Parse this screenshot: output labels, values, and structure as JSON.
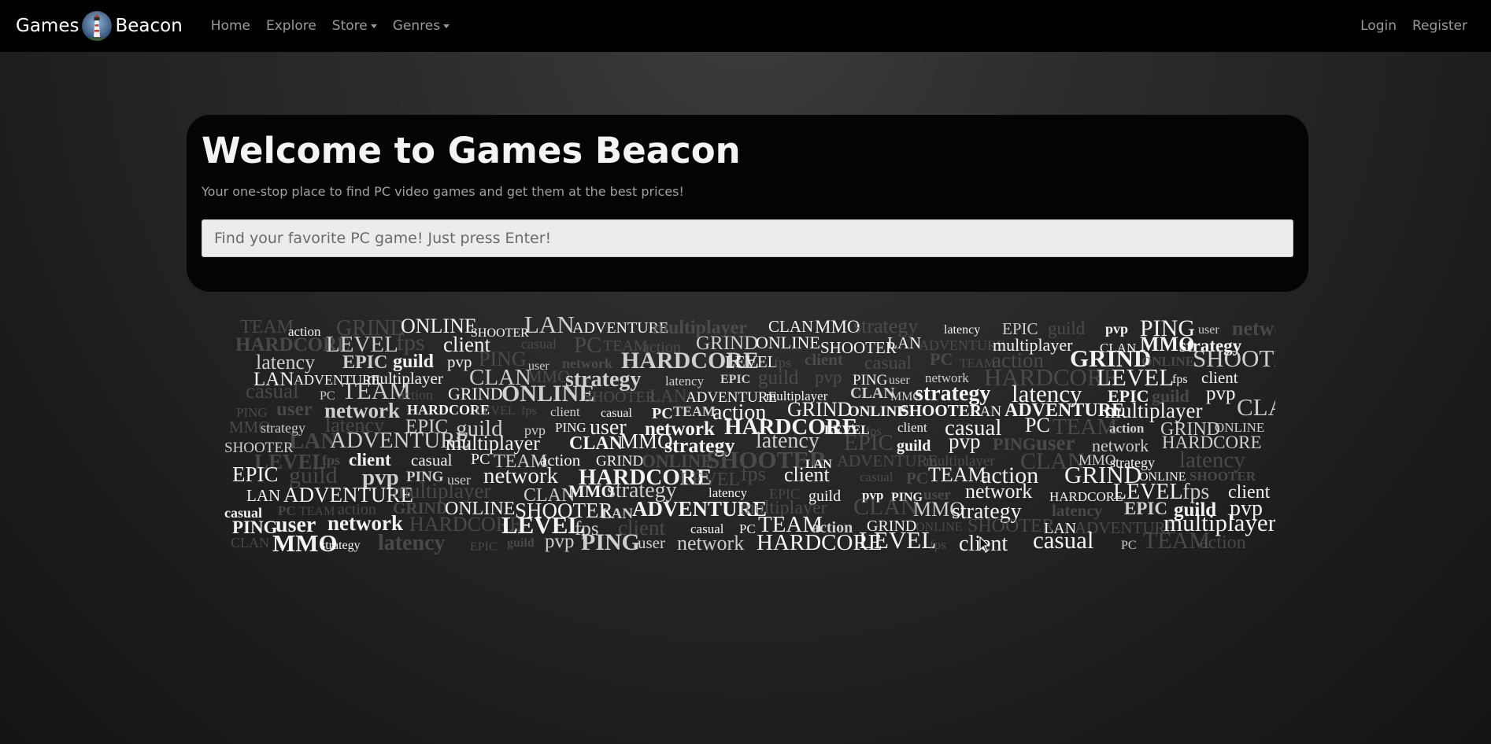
{
  "navbar": {
    "brand_left": "Games",
    "brand_right": "Beacon",
    "logo_icon": "lighthouse-logo-icon",
    "links": [
      {
        "label": "Home",
        "dropdown": false
      },
      {
        "label": "Explore",
        "dropdown": false
      },
      {
        "label": "Store",
        "dropdown": true
      },
      {
        "label": "Genres",
        "dropdown": true
      }
    ],
    "auth": {
      "login": "Login",
      "register": "Register"
    }
  },
  "hero": {
    "title": "Welcome to Games Beacon",
    "subtitle": "Your one-stop place to find PC video games and get them at the best prices!",
    "search_placeholder": "Find your favorite PC game! Just press Enter!"
  },
  "word_cloud": {
    "words": [
      "TEAM",
      "action",
      "GRIND",
      "ONLINE",
      "SHOOTER",
      "LAN",
      "ADVENTURE",
      "multiplayer",
      "CLAN",
      "MMO",
      "strategy",
      "latency",
      "EPIC",
      "guild",
      "pvp",
      "PING",
      "user",
      "network",
      "HARDCORE",
      "LEVEL",
      "fps",
      "client",
      "casual",
      "PC"
    ]
  },
  "colors": {
    "navbar_bg": "#000000",
    "hero_bg": "#040404",
    "text_primary": "#f4f4f4",
    "text_muted": "#a0a0a0"
  }
}
